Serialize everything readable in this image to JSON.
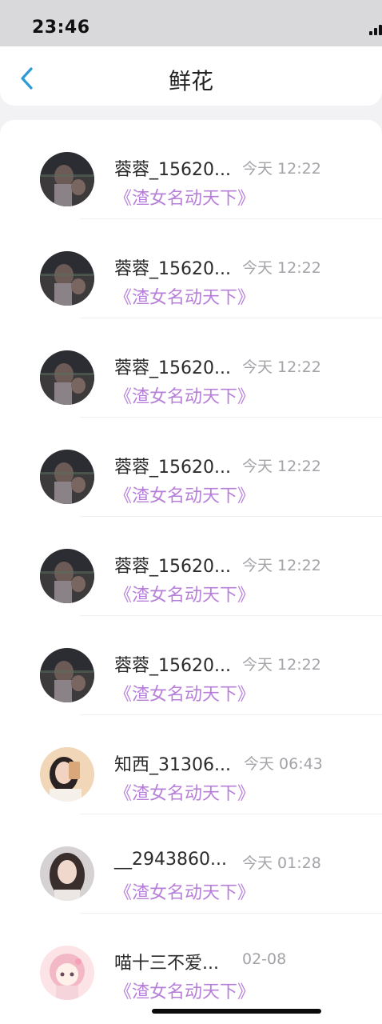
{
  "status_bar": {
    "time": "23:46"
  },
  "nav": {
    "title": "鲜花",
    "back_icon": "chevron-left-icon",
    "accent": "#2a9bd6"
  },
  "colors": {
    "book": "#b77fd9",
    "time": "#a3a3a8"
  },
  "items": [
    {
      "name": "蓉蓉_15620...",
      "time": "今天 12:22",
      "book": "《渣女名动天下》",
      "avatar": "dark-night-photo"
    },
    {
      "name": "蓉蓉_15620...",
      "time": "今天 12:22",
      "book": "《渣女名动天下》",
      "avatar": "dark-night-photo"
    },
    {
      "name": "蓉蓉_15620...",
      "time": "今天 12:22",
      "book": "《渣女名动天下》",
      "avatar": "dark-night-photo"
    },
    {
      "name": "蓉蓉_15620...",
      "time": "今天 12:22",
      "book": "《渣女名动天下》",
      "avatar": "dark-night-photo"
    },
    {
      "name": "蓉蓉_15620...",
      "time": "今天 12:22",
      "book": "《渣女名动天下》",
      "avatar": "dark-night-photo"
    },
    {
      "name": "蓉蓉_15620...",
      "time": "今天 12:22",
      "book": "《渣女名动天下》",
      "avatar": "dark-night-photo"
    },
    {
      "name": "知西_31306...",
      "time": "今天 06:43",
      "book": "《渣女名动天下》",
      "avatar": "girl-selfie-photo"
    },
    {
      "name": "__2943860...",
      "time": "今天 01:28",
      "book": "《渣女名动天下》",
      "avatar": "girl-portrait-photo"
    },
    {
      "name": "喵十三不爱...",
      "time": "02-08",
      "book": "《渣女名动天下》",
      "avatar": "anime-girl-avatar"
    }
  ]
}
